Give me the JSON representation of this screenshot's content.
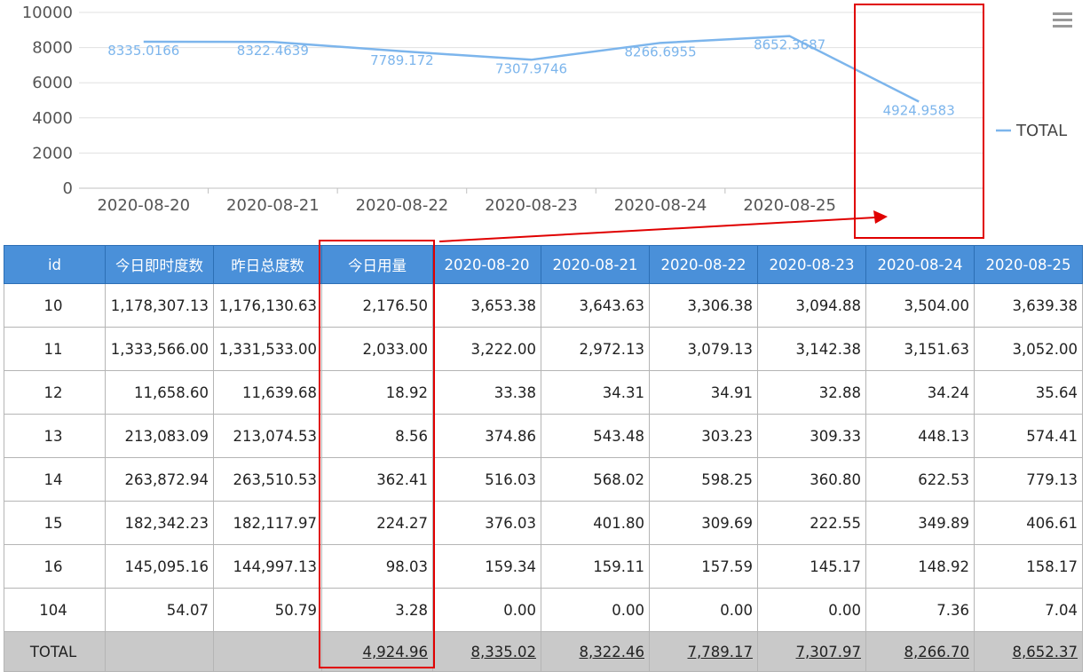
{
  "chart_data": {
    "type": "line",
    "categories": [
      "2020-08-20",
      "2020-08-21",
      "2020-08-22",
      "2020-08-23",
      "2020-08-24",
      "2020-08-25",
      ""
    ],
    "series": [
      {
        "name": "TOTAL",
        "values": [
          8335.0166,
          8322.4639,
          7789.172,
          7307.9746,
          8266.6955,
          8652.3687,
          4924.9583
        ],
        "labels": [
          "8335.0166",
          "8322.4639",
          "7789.172",
          "7307.9746",
          "8266.6955",
          "8652.3687",
          "4924.9583"
        ]
      }
    ],
    "y_ticks": [
      "0",
      "2000",
      "4000",
      "6000",
      "8000",
      "10000"
    ],
    "ylim": [
      0,
      10000
    ],
    "grid": true,
    "legend": "right",
    "colors": {
      "line": "#7cb5ec",
      "header": "#4a90d9",
      "highlight": "#e00000"
    }
  },
  "menu": {
    "icon": "menu-icon"
  },
  "table": {
    "headers": [
      "id",
      "今日即时度数",
      "昨日总度数",
      "今日用量",
      "2020-08-20",
      "2020-08-21",
      "2020-08-22",
      "2020-08-23",
      "2020-08-24",
      "2020-08-25"
    ],
    "rows": [
      [
        "10",
        "1,178,307.13",
        "1,176,130.63",
        "2,176.50",
        "3,653.38",
        "3,643.63",
        "3,306.38",
        "3,094.88",
        "3,504.00",
        "3,639.38"
      ],
      [
        "11",
        "1,333,566.00",
        "1,331,533.00",
        "2,033.00",
        "3,222.00",
        "2,972.13",
        "3,079.13",
        "3,142.38",
        "3,151.63",
        "3,052.00"
      ],
      [
        "12",
        "11,658.60",
        "11,639.68",
        "18.92",
        "33.38",
        "34.31",
        "34.91",
        "32.88",
        "34.24",
        "35.64"
      ],
      [
        "13",
        "213,083.09",
        "213,074.53",
        "8.56",
        "374.86",
        "543.48",
        "303.23",
        "309.33",
        "448.13",
        "574.41"
      ],
      [
        "14",
        "263,872.94",
        "263,510.53",
        "362.41",
        "516.03",
        "568.02",
        "598.25",
        "360.80",
        "622.53",
        "779.13"
      ],
      [
        "15",
        "182,342.23",
        "182,117.97",
        "224.27",
        "376.03",
        "401.80",
        "309.69",
        "222.55",
        "349.89",
        "406.61"
      ],
      [
        "16",
        "145,095.16",
        "144,997.13",
        "98.03",
        "159.34",
        "159.11",
        "157.59",
        "145.17",
        "148.92",
        "158.17"
      ],
      [
        "104",
        "54.07",
        "50.79",
        "3.28",
        "0.00",
        "0.00",
        "0.00",
        "0.00",
        "7.36",
        "7.04"
      ]
    ],
    "total": [
      "TOTAL",
      "",
      "",
      "4,924.96",
      "8,335.02",
      "8,322.46",
      "7,789.17",
      "7,307.97",
      "8,266.70",
      "8,652.37"
    ]
  }
}
